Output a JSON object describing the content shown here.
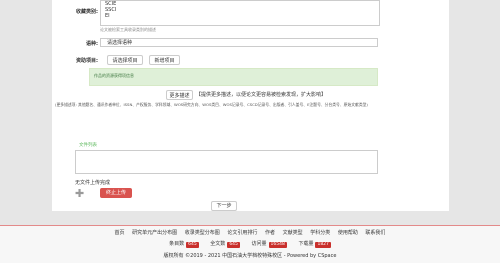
{
  "form": {
    "category_label": "收藏类别:",
    "category_options": [
      "SCIE",
      "SSCI",
      "EI"
    ],
    "category_hint": "论文被检索工具收录类别的描述",
    "language_label": "语种:",
    "language_placeholder": "请选择语种",
    "project_label": "资助项目:",
    "select_project_button": "请选择项目",
    "add_project_button": "新增项目",
    "project_alert": "作品的资源获得项信息",
    "more_desc_button": "更多描述",
    "desc_note": "【提供更多描述，以便论文更容易被检索发现，扩大影响】",
    "tag_note": "(更多描述项: 其他题名、通讯作者单位、ISSN、产权服务、学科领域、WOS研究方向、WOS类目、WOS记录号、CSCD记录号、出版者、引人盖号、E注题号、分台类号、原始文献类型)"
  },
  "files": {
    "title": "文件列表",
    "no_upload_text": "无文件上传完成",
    "stop_upload_button": "终止上传",
    "next_button": "下一步"
  },
  "footer": {
    "nav": [
      "首页",
      "研究单元产出分布图",
      "收录类型分布图",
      "论文引用排行",
      "作者",
      "文献类型",
      "学科分类",
      "使用帮助",
      "联系我们"
    ],
    "stats": [
      {
        "label": "条目数",
        "value": "645"
      },
      {
        "label": "全文数",
        "value": "645"
      },
      {
        "label": "访问量",
        "value": "16548"
      },
      {
        "label": "下载量",
        "value": "1827"
      }
    ],
    "copyright": "版权所有 ©2019 - 2021 中国石油大学档校特殊校区 - Powered by CSpace"
  },
  "colors": {
    "accent_red": "#c9302c",
    "alert_green": "#dff0d8",
    "title_green": "#5cb85c"
  }
}
